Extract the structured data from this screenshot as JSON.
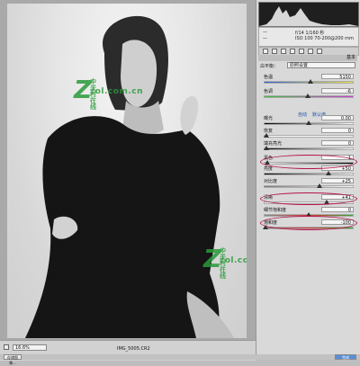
{
  "watermarks": [
    {
      "letter": "Z",
      "cn": "中关村在线",
      "domain": "zol.com.cn"
    },
    {
      "letter": "Z",
      "cn": "中关村在线",
      "domain": "zol.com.cn"
    }
  ],
  "metadata": {
    "dash1": "—",
    "dash2": "—",
    "shutter": "f/14  1/160 秒",
    "iso": "ISO 100  70-200@200 mm"
  },
  "panel": {
    "section_title": "基本",
    "white_balance_label": "白平衡：",
    "white_balance_value": "原照设置",
    "auto": "自动",
    "default": "默认值"
  },
  "controls": [
    {
      "label": "色温",
      "value": "5150",
      "level": 0.52
    },
    {
      "label": "色调",
      "value": "-6",
      "level": 0.49
    },
    {
      "label": "曝光",
      "value": "0.00",
      "level": 0.5
    },
    {
      "label": "恢复",
      "value": "0",
      "level": 0.02
    },
    {
      "label": "填充亮光",
      "value": "0",
      "level": 0.02
    },
    {
      "label": "黑色",
      "value": "1",
      "level": 0.03
    },
    {
      "label": "亮度",
      "value": "+50",
      "level": 0.72
    },
    {
      "label": "对比度",
      "value": "+25",
      "level": 0.62
    },
    {
      "label": "清晰",
      "value": "+41",
      "level": 0.7
    },
    {
      "label": "细节饱和度",
      "value": "0",
      "level": 0.5
    },
    {
      "label": "饱和度",
      "value": "-100",
      "level": 0.01
    }
  ],
  "status": {
    "zoom": "16.6%",
    "filename": "IMG_5005.CR2"
  },
  "buttons": {
    "save": "存储图像...",
    "done": "完成"
  }
}
